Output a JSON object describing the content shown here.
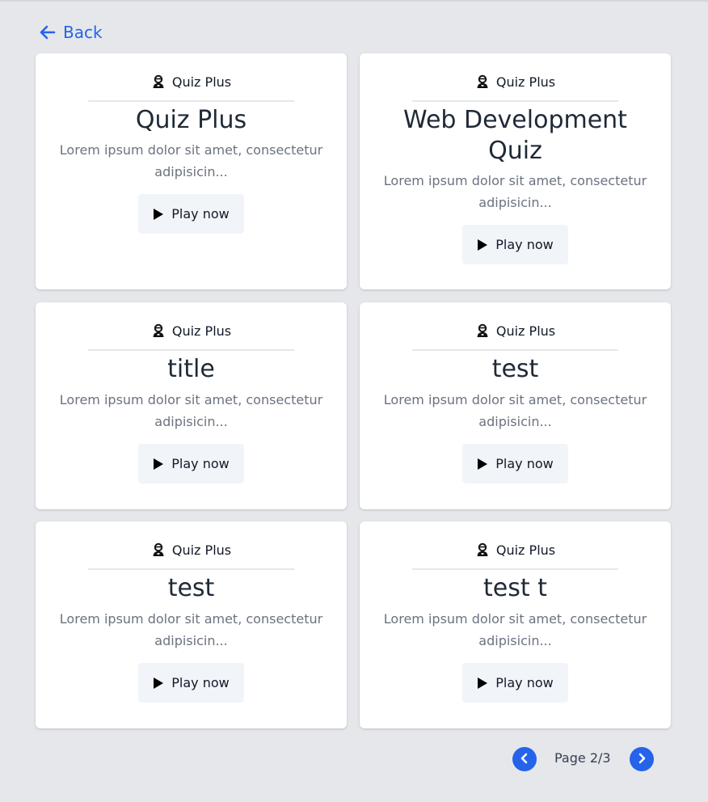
{
  "nav": {
    "back_label": "Back"
  },
  "brand_name": "Quiz Plus",
  "quizzes": [
    {
      "title": "Quiz Plus",
      "description": "Lorem ipsum dolor sit amet, consectetur adipisicin...",
      "button": "Play now"
    },
    {
      "title": "Web Development Quiz",
      "description": "Lorem ipsum dolor sit amet, consectetur adipisicin...",
      "button": "Play now"
    },
    {
      "title": "title",
      "description": "Lorem ipsum dolor sit amet, consectetur adipisicin...",
      "button": "Play now"
    },
    {
      "title": "test",
      "description": "Lorem ipsum dolor sit amet, consectetur adipisicin...",
      "button": "Play now"
    },
    {
      "title": "test",
      "description": "Lorem ipsum dolor sit amet, consectetur adipisicin...",
      "button": "Play now"
    },
    {
      "title": "test t",
      "description": "Lorem ipsum dolor sit amet, consectetur adipisicin...",
      "button": "Play now"
    }
  ],
  "pagination": {
    "label": "Page 2/3"
  },
  "icons": {
    "back": "arrow-left-icon",
    "brand": "user-avatar-icon",
    "play": "play-icon",
    "prev": "chevron-left-icon",
    "next": "chevron-right-icon"
  },
  "colors": {
    "accent": "#2563eb",
    "background": "#e5e7eb",
    "card": "#ffffff",
    "button_bg": "#f1f5f9"
  }
}
